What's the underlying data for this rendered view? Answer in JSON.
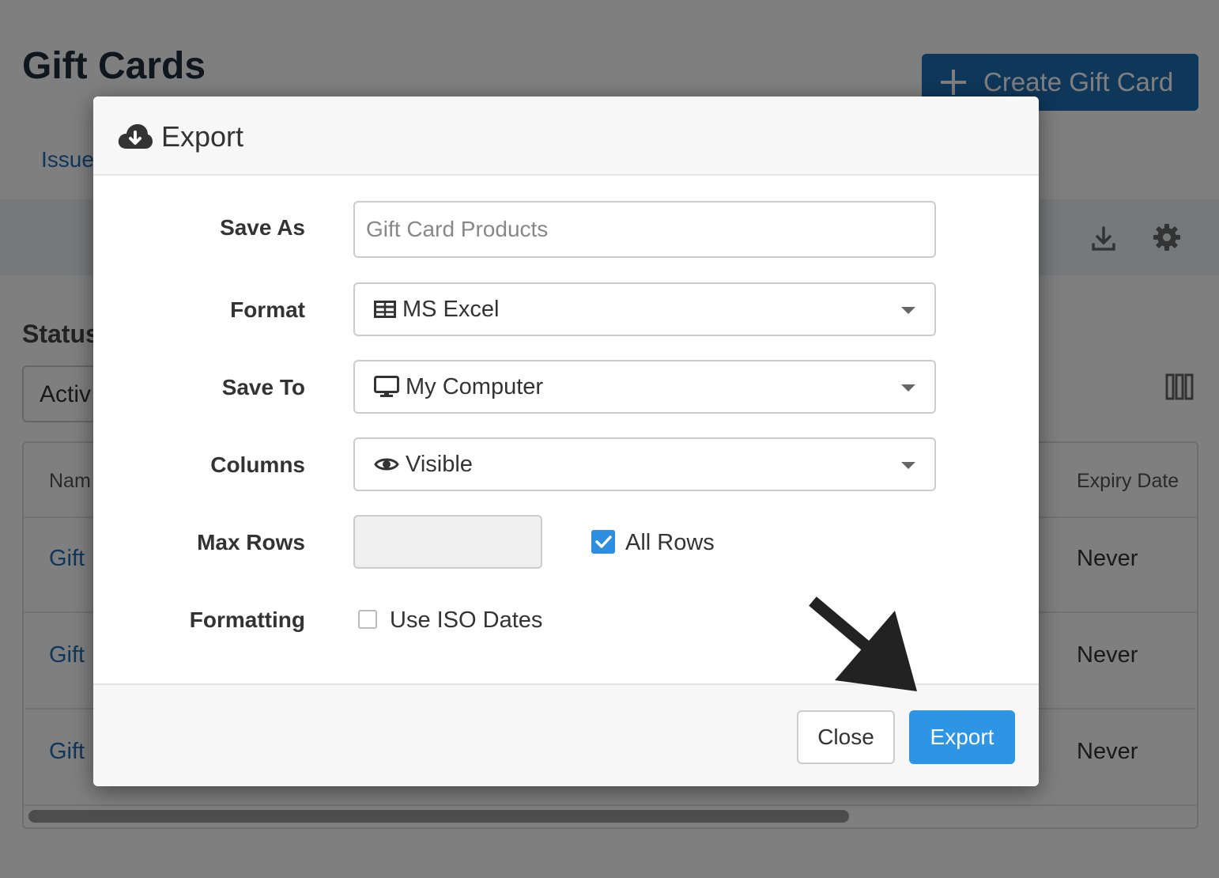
{
  "page": {
    "title": "Gift Cards",
    "create_button_label": "Create Gift Card",
    "tab_issued": "Issue",
    "status_label": "Status",
    "status_value": "Activ",
    "table": {
      "columns": [
        "Nam",
        "Expiry Date"
      ],
      "rows": [
        {
          "name": "Gift",
          "expiry": "Never"
        },
        {
          "name": "Gift",
          "expiry": "Never"
        },
        {
          "name": "Gift",
          "expiry": "Never"
        }
      ]
    }
  },
  "modal": {
    "title": "Export",
    "fields": {
      "save_as": {
        "label": "Save As",
        "placeholder": "Gift Card Products",
        "value": ""
      },
      "format": {
        "label": "Format",
        "value": "MS Excel",
        "icon": "table-icon"
      },
      "save_to": {
        "label": "Save To",
        "value": "My Computer",
        "icon": "desktop-icon"
      },
      "columns": {
        "label": "Columns",
        "value": "Visible",
        "icon": "eye-icon"
      },
      "max_rows": {
        "label": "Max Rows",
        "value": "",
        "all_rows_label": "All Rows",
        "all_rows_checked": true
      },
      "formatting": {
        "label": "Formatting",
        "iso_dates_label": "Use ISO Dates",
        "iso_dates_checked": false
      }
    },
    "buttons": {
      "close": "Close",
      "export": "Export"
    }
  },
  "colors": {
    "primary_button": "#1f6fb5",
    "export_button": "#2d95e3",
    "link": "#1f6fb5",
    "checkbox_checked": "#2d8ee0"
  }
}
